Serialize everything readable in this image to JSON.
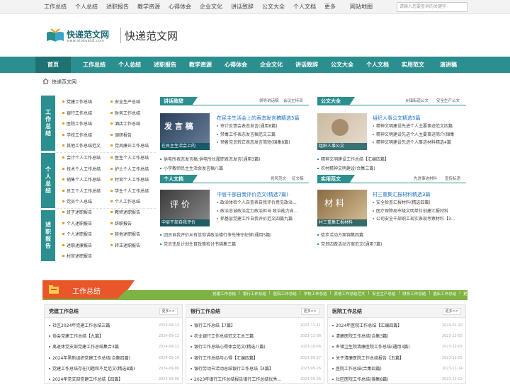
{
  "topbar": {
    "links": [
      "工作总结",
      "个人总结",
      "述职报告",
      "教学资源",
      "心得体会",
      "企业文化",
      "讲话致辞",
      "公文大全",
      "个人文档",
      "更多",
      "网站地图"
    ],
    "search_placeholder": "请输入您要查询的关键字"
  },
  "header": {
    "logo_text": "快递范文网",
    "logo_domain": "www.stokuaidi.com",
    "site_title": "快递范文网"
  },
  "nav": [
    "首页",
    "工作总结",
    "个人总结",
    "述职报告",
    "教学资源",
    "心得体会",
    "企业文化",
    "讲话致辞",
    "公文大全",
    "个人文档",
    "实用范文",
    "演讲稿"
  ],
  "breadcrumb": "快递范文网",
  "sidebar": {
    "groups": [
      {
        "title": "工作总结",
        "col1": [
          "党建工作总结",
          "银行工作总结",
          "医院工作总结",
          "学校工作总结",
          "其他工作总结范文"
        ],
        "col2": [
          "安全生产总结",
          "财务工作总结",
          "酒店工作总结",
          "调研报告",
          "党风廉正工作总结"
        ]
      },
      {
        "title": "个人总结",
        "col1": [
          "会计个人工作总结",
          "技术个人工作总结",
          "销售个人工作总结",
          "员工个人工作总结",
          "党员个人总结"
        ],
        "col2": [
          "医生个人工作总结",
          "护士个人工作总结",
          "村官个人工作总结",
          "学生个人工作总结",
          "个人工作总结"
        ]
      },
      {
        "title": "述职报告",
        "col1": [
          "班子述职报告",
          "个人述职报告",
          "个人述职报告",
          "述职述廉报告",
          "村官述职报告"
        ],
        "col2": [
          "教师述职报告",
          "辞职报告",
          "其他述职报告",
          "转正述职报告"
        ]
      }
    ]
  },
  "panels": {
    "speech": {
      "tab": "讲话致辞",
      "more": [
        "领导讲话稿",
        "会议主持词"
      ],
      "thumb_caption": "在民主生活会上的",
      "feature_title": "在民主生活会上的表态发言稿精选5篇",
      "feature_items": [
        "审计反馈会表态发言(通用8篇)",
        "禁毒工作表态发言稿范文三篇",
        "预备党员转正表态发言简短(锦集8篇)"
      ],
      "items": [
        "供电所表态发言稿:供电所长履职表态发言(通用3篇)",
        "小学教师民主生活会发言稿八篇"
      ]
    },
    "docs": {
      "tab": "公文大全",
      "more": [
        "乡镇街道公文",
        "安全生产公文"
      ],
      "thumb_caption": "组织人事公文",
      "feature_title": "组织人事公文精选5篇",
      "feature_items": [
        "精神文明建设先进个人主要事迹范文四篇",
        "精神文明建设先进个人主要事迹简介(锦集",
        "精神文明建设先进个人事迹材料精选4篇"
      ],
      "items": [
        "精神文明建设工作总结【汇编四篇】",
        "农村精神文明建设(合集三篇)"
      ]
    },
    "personal": {
      "tab": "个人文档",
      "more": [
        "党风范文",
        "征文稿"
      ],
      "thumb_caption": "中层干部自我评价",
      "feature_title": "中层干部自我评价范文(精选7篇)",
      "feature_items": [
        "政治体检个人自查表自我评价意见政治...",
        "政治忠诚政治定力政治担当 政治能力自...",
        "抓基层党建工作自我评价范文四篇九篇"
      ],
      "items": [
        "团员自我评价从有信仰讲政治德行争先锋守纪律(通用5篇)",
        "党员违反计划生育政策检讨书锦集三篇"
      ]
    },
    "practical": {
      "tab": "实用范文",
      "more": [
        "先进事迹材料",
        "宣传标语"
      ],
      "thumb_caption": "村三重集汇报材料",
      "feature_title": "村三重集汇报材料精选3篇",
      "feature_items": [
        "安全检查汇报材料(精选四篇)",
        "医疗保障局市级文明单位创建汇报材料",
        "公司安全干部职工现实表现考察材料【3..."
      ],
      "items": [
        "徒步活动方案锦集四篇",
        "党员四做活动方案范文(通用7篇)"
      ]
    }
  },
  "section": {
    "title": "工作总结",
    "links": [
      "党建工作总结",
      "银行工作总结",
      "医院工作总结",
      "学校工作总结",
      "其他工作总结范文",
      "安全生产总结",
      "财务工作总结",
      "酒店工作总结",
      "更多>>"
    ]
  },
  "bottom": [
    {
      "title": "党建工作总结",
      "more": "更多>>",
      "rows": [
        [
          "社区2024年党建工作总结三篇",
          "2024-09-13"
        ],
        [
          "协会党建工作总结【九篇】",
          "2024-09-12"
        ],
        [
          "离退休党支部党建工作总结集合3篇",
          "2024-09-11"
        ],
        [
          "2024年黑新组织党建工作总结(合集四篇)",
          "2024-09-10"
        ],
        [
          "党建工作总结存在问题和不足范文(精选8篇)",
          "2024-09-06"
        ],
        [
          "2024年党支部党建工作总结【四篇】",
          "2024-09-06"
        ]
      ]
    },
    {
      "title": "银行工作总结",
      "more": "更多>>",
      "rows": [
        [
          "银行工作总结【7篇】",
          "2023-11-11"
        ],
        [
          "农业银行工作总结范文汇总三篇",
          "2023-11-08"
        ],
        [
          "银行工作总结心得体会范文(精选八篇)",
          "2023-10-06"
        ],
        [
          "银行工作总结与心得【汇编四篇】",
          "2023-09-27"
        ],
        [
          "银行劳动节活动总结银行工作总结【4篇】",
          "2023-09-26"
        ],
        [
          "2023年银行工作总结报告银行工作总结优秀...",
          "2023-09-26"
        ]
      ]
    },
    {
      "title": "医院工作总结",
      "more": "更多>>",
      "rows": [
        [
          "2024年医院工作总结【汇编四篇】",
          "2024-01-20"
        ],
        [
          "清廉医院工作总结(合集3篇)",
          "2023-12-05"
        ],
        [
          "乡镇卫生院清廉医院工作总结(通用3篇)",
          "2023-12-05"
        ],
        [
          "关于清廉医院工作总结报告【五篇】",
          "2023-12-05"
        ],
        [
          "医院工作总结(合集四篇)",
          "2023-11-14"
        ],
        [
          "社区医院工作总结(锦集8篇)",
          "2023-11-02"
        ]
      ]
    }
  ]
}
